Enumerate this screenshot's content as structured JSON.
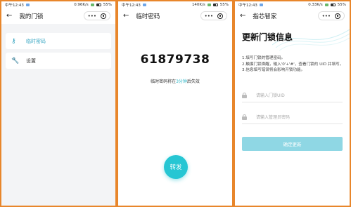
{
  "panel1": {
    "status": {
      "time": "中午12:43",
      "speed": "0.96K/s",
      "battery": "55%"
    },
    "nav": {
      "title": "我的门锁",
      "back_icon": "arrow-left-icon",
      "more_label": "•••"
    },
    "menu": [
      {
        "label": "临时密码",
        "icon": "key-icon"
      },
      {
        "label": "设置",
        "icon": "wrench-icon"
      }
    ]
  },
  "panel2": {
    "status": {
      "time": "中午12:43",
      "speed": "140K/s",
      "battery": "55%"
    },
    "nav": {
      "title": "临时密码",
      "more_label": "•••"
    },
    "code": "61879738",
    "expire_prefix": "临时密码将在",
    "expire_highlight": "3分钟",
    "expire_suffix": "后失效",
    "fab_label": "转发",
    "accent": "#26c6d3"
  },
  "panel3": {
    "status": {
      "time": "中午12:43",
      "speed": "0.33K/s",
      "battery": "55%"
    },
    "nav": {
      "title": "指芯智家",
      "more_label": "•••"
    },
    "heading": "更新门锁信息",
    "instructions": [
      "1.填写门锁的管理密码。",
      "2.触摸门锁唤醒，输入'0'+'#'，查看门锁的 UID 并填写。",
      "3.信息填写错误将会影响开锁功能。"
    ],
    "uid_placeholder": "请输入门锁UID",
    "password_placeholder": "请输入管理员密码",
    "submit_label": "确定更新",
    "submit_color": "#8fd7e4"
  }
}
